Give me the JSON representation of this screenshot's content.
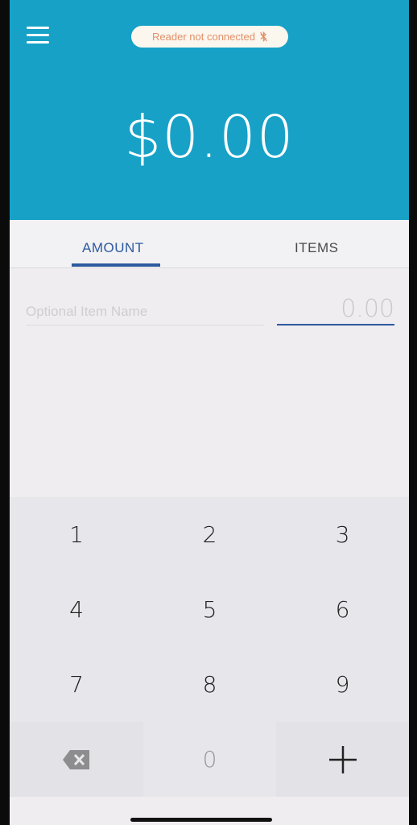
{
  "header": {
    "reader_status": "Reader not connected",
    "amount": "$0.00",
    "colors": {
      "header_bg": "#17a1c7",
      "accent": "#2c5aa0",
      "status_text": "#e39069"
    },
    "icons": {
      "menu": "hamburger-menu-icon",
      "bluetooth": "bluetooth-off-icon"
    }
  },
  "tabs": [
    {
      "label": "AMOUNT",
      "active": true
    },
    {
      "label": "ITEMS",
      "active": false
    }
  ],
  "entry": {
    "item_name_placeholder": "Optional Item Name",
    "price_placeholder": "0.00"
  },
  "keypad": {
    "keys": [
      "1",
      "2",
      "3",
      "4",
      "5",
      "6",
      "7",
      "8",
      "9",
      "0"
    ],
    "backspace_icon": "backspace-icon",
    "add_icon": "plus-icon"
  }
}
